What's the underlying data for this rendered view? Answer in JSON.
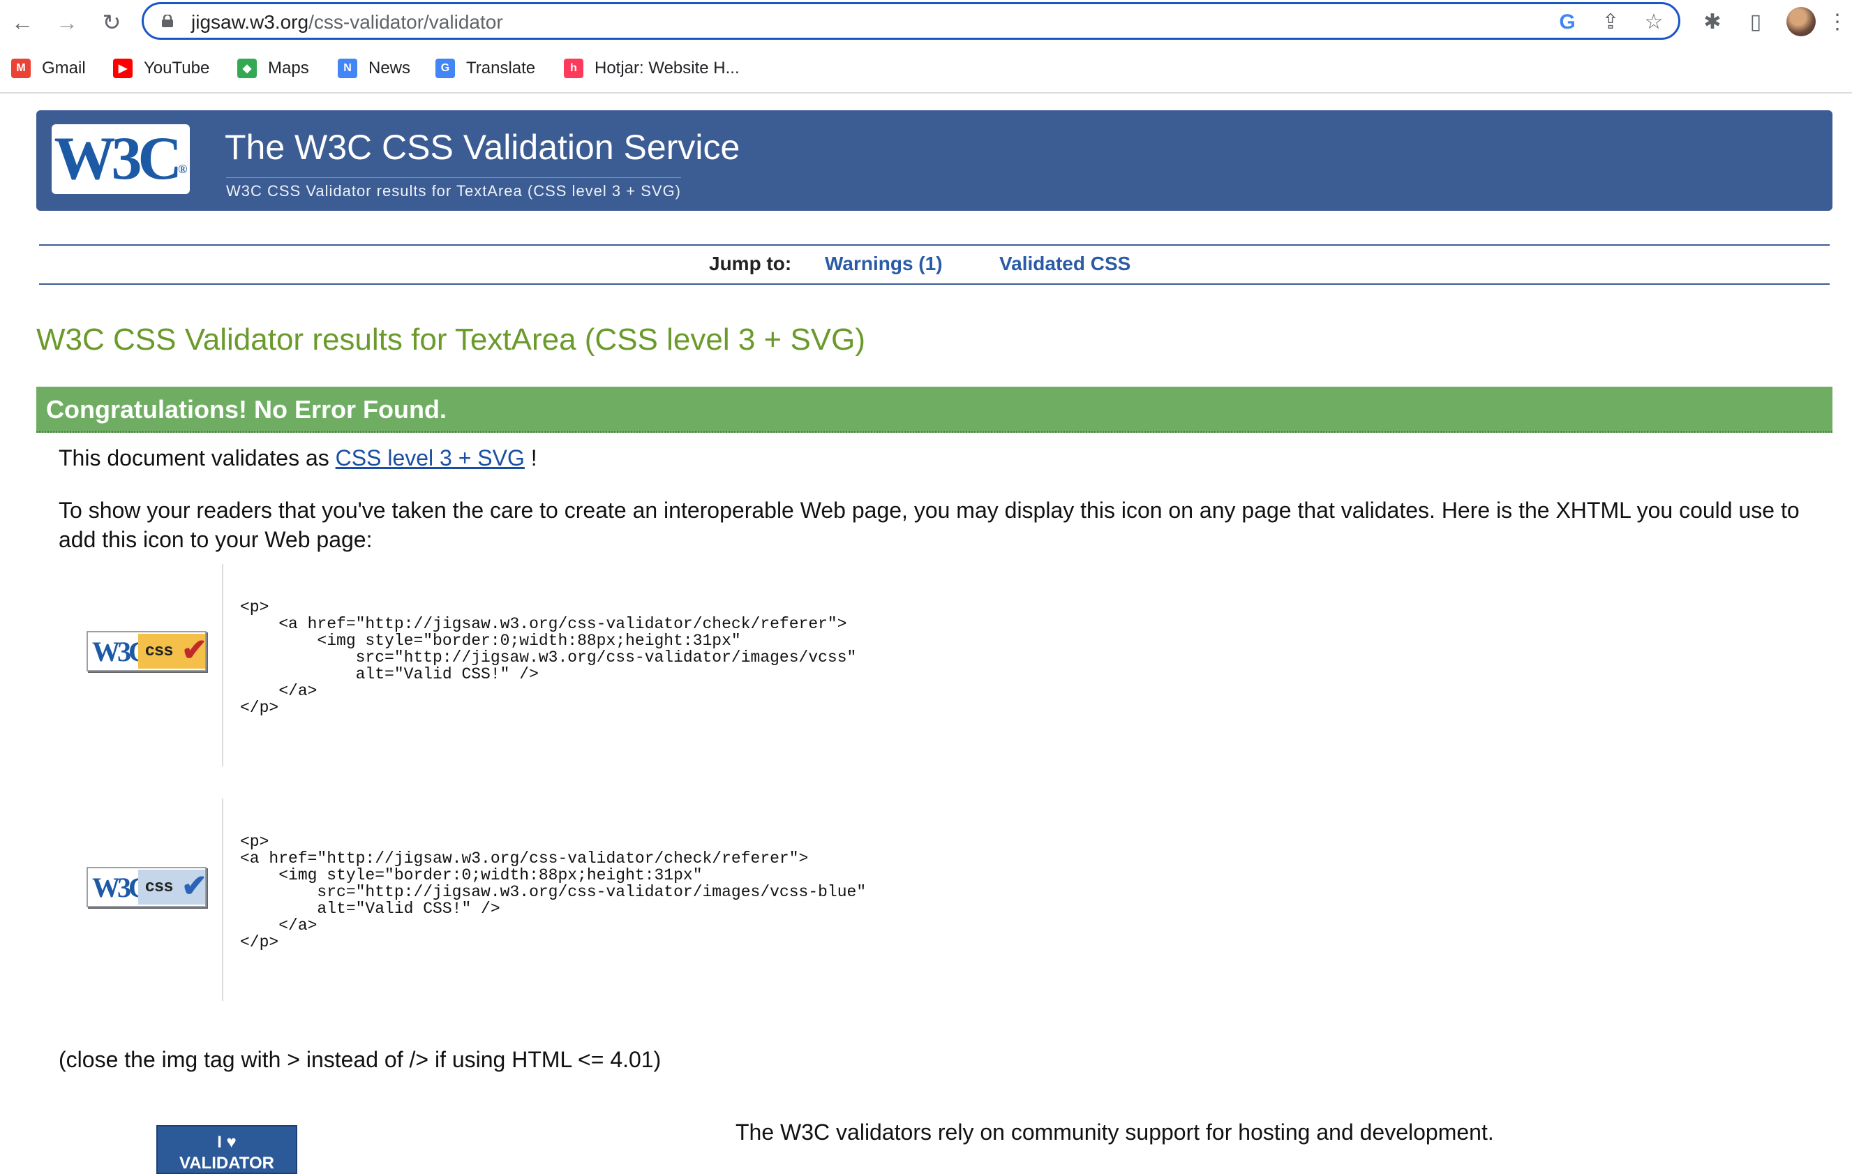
{
  "browser": {
    "url_host": "jigsaw.w3.org",
    "url_path": "/css-validator/validator",
    "nav": {
      "back": "←",
      "forward": "→",
      "reload": "↻"
    },
    "omnibox_icons": {
      "google": "G",
      "share": "⇪",
      "star": "☆"
    },
    "toolbar_icons": {
      "extensions": "✱",
      "sidepanel": "▯",
      "menu": "⋮"
    }
  },
  "bookmarks": [
    {
      "label": "Gmail",
      "icon": "M",
      "color": "#ea4335"
    },
    {
      "label": "YouTube",
      "icon": "▶",
      "color": "#ff0000"
    },
    {
      "label": "Maps",
      "icon": "◆",
      "color": "#34a853"
    },
    {
      "label": "News",
      "icon": "N",
      "color": "#4285f4"
    },
    {
      "label": "Translate",
      "icon": "G",
      "color": "#4285f4"
    },
    {
      "label": "Hotjar: Website H...",
      "icon": "h",
      "color": "#fd3a5c"
    }
  ],
  "header": {
    "logo": "W3C",
    "logo_mark": "®",
    "title": "The W3C CSS Validation Service",
    "subtitle": "W3C CSS Validator results for TextArea (CSS level 3 + SVG)"
  },
  "jump": {
    "label": "Jump to:",
    "warnings": "Warnings (1)",
    "validated": "Validated CSS"
  },
  "results": {
    "title": "W3C CSS Validator results for TextArea (CSS level 3 + SVG)",
    "congrats": "Congratulations! No Error Found.",
    "validates_prefix": "This document validates as",
    "validates_link": "CSS level 3 + SVG",
    "validates_suffix": "!",
    "icon_paragraph": "To show your readers that you've taken the care to create an interoperable Web page, you may display this icon on any page that validates. Here is the XHTML you could use to add this icon to your Web page:",
    "badge_w3c": "W3C",
    "badge_css": "css",
    "badge_tick": "✔",
    "badge_colors": {
      "gold": "#f5c04a",
      "gold_tick": "#c0282d",
      "blue": "#c6d6ea",
      "blue_tick": "#2a64b8"
    },
    "code1": "<p>\n    <a href=\"http://jigsaw.w3.org/css-validator/check/referer\">\n        <img style=\"border:0;width:88px;height:31px\"\n            src=\"http://jigsaw.w3.org/css-validator/images/vcss\"\n            alt=\"Valid CSS!\" />\n    </a>\n</p>",
    "code2": "<p>\n<a href=\"http://jigsaw.w3.org/css-validator/check/referer\">\n    <img style=\"border:0;width:88px;height:31px\"\n        src=\"http://jigsaw.w3.org/css-validator/images/vcss-blue\"\n        alt=\"Valid CSS!\" />\n    </a>\n</p>",
    "close_note": "(close the img tag with > instead of /> if using HTML <= 4.01)",
    "donate_badge": "I ♥\nVALIDATOR",
    "community": "The W3C validators rely on community support for hosting and development."
  }
}
